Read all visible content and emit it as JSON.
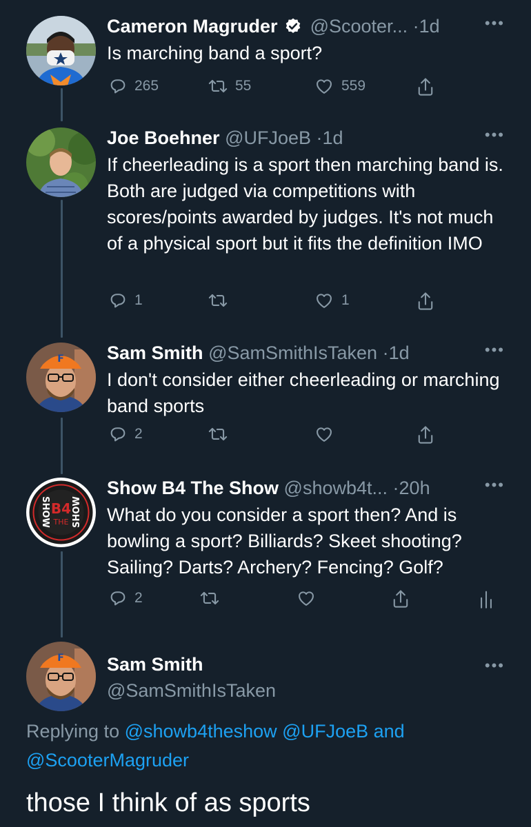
{
  "tweets": [
    {
      "name": "Cameron Magruder",
      "handle": "@Scooter...",
      "time": "1d",
      "text": "Is marching band a sport?",
      "reply_count": "265",
      "retweet_count": "55",
      "like_count": "559"
    },
    {
      "name": "Joe Boehner",
      "handle": "@UFJoeB",
      "time": "1d",
      "text": "If cheerleading is a sport then marching band is. Both are judged via competitions with scores/points awarded by judges. It's not much of a physical sport but it fits the definition IMO",
      "reply_count": "1",
      "retweet_count": "",
      "like_count": "1"
    },
    {
      "name": "Sam Smith",
      "handle": "@SamSmithIsTaken",
      "time": "1d",
      "text": "I don't consider either cheerleading or marching band sports",
      "reply_count": "2",
      "retweet_count": "",
      "like_count": ""
    },
    {
      "name": "Show B4 The Show",
      "handle": "@showb4t...",
      "time": "20h",
      "text": "What do you consider a sport then? And is bowling a sport? Billiards? Skeet shooting? Sailing? Darts? Archery? Fencing? Golf?",
      "reply_count": "2",
      "retweet_count": "",
      "like_count": ""
    }
  ],
  "focused": {
    "name": "Sam Smith",
    "handle": "@SamSmithIsTaken",
    "replying_prefix": "Replying to",
    "replying_handles": [
      "@showb4theshow",
      "@UFJoeB",
      "@ScooterMagruder"
    ],
    "replying_and": "and",
    "text": "those I think of as sports"
  },
  "logo": {
    "top": "SHOW",
    "mid1": "B4",
    "mid2": "THE",
    "bottom": "SHOW"
  },
  "separator_dot": "·",
  "more_glyph": "•••",
  "icons": {
    "reply": "reply-icon",
    "retweet": "retweet-icon",
    "like": "heart-icon",
    "share": "share-icon",
    "analytics": "analytics-icon",
    "more": "more-icon",
    "verified": "verified-badge-icon"
  },
  "colors": {
    "background": "#15202b",
    "text": "#ffffff",
    "muted": "#8899a6",
    "link": "#1da1f2",
    "thread_line": "#3d5466"
  }
}
